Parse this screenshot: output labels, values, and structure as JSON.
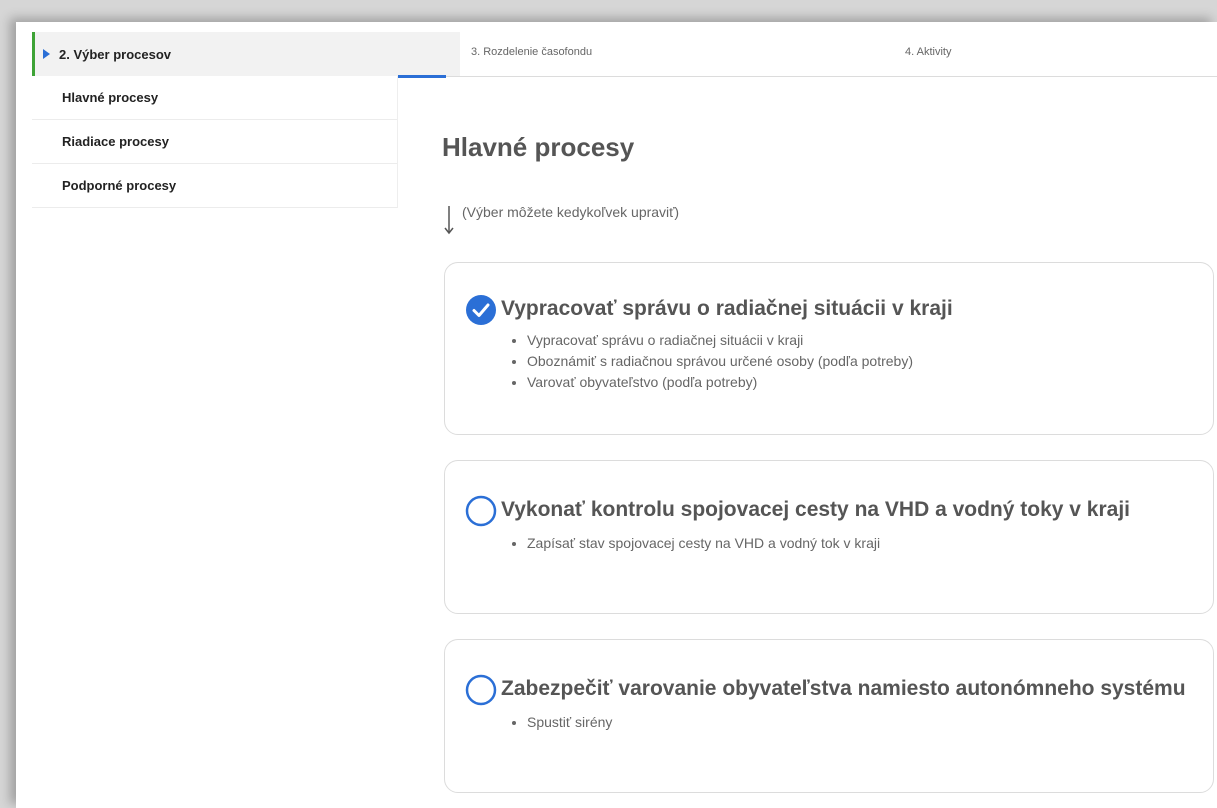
{
  "steps": {
    "active": "2. Výber procesov",
    "step3": "3. Rozdelenie časofondu",
    "step4": "4. Aktivity"
  },
  "sidebar": {
    "items": [
      {
        "label": "Hlavné procesy"
      },
      {
        "label": "Riadiace procesy"
      },
      {
        "label": "Podporné procesy"
      }
    ]
  },
  "main": {
    "title": "Hlavné procesy",
    "hint": "(Výber môžete kedykoľvek upraviť)"
  },
  "processes": [
    {
      "title": "Vypracovať správu o radiačnej situácii v kraji",
      "selected": true,
      "items": [
        "Vypracovať správu o radiačnej situácii v kraji",
        "Oboznámiť s radiačnou správou určené osoby (podľa potreby)",
        "Varovať obyvateľstvo (podľa potreby)"
      ]
    },
    {
      "title": "Vykonať kontrolu spojovacej cesty na VHD a vodný toky v kraji",
      "selected": false,
      "items": [
        "Zapísať stav spojovacej cesty na VHD a vodný tok v kraji"
      ]
    },
    {
      "title": "Zabezpečiť varovanie obyvateľstva namiesto autonómneho systému",
      "selected": false,
      "items": [
        "Spustiť sirény"
      ]
    }
  ],
  "colors": {
    "accent": "#2b6fd6",
    "active_marker": "#3ea336"
  },
  "icons": {
    "selected": "check-circle-icon",
    "unselected": "empty-circle-icon",
    "hint": "arrow-down-icon",
    "step_caret": "caret-right-icon"
  }
}
